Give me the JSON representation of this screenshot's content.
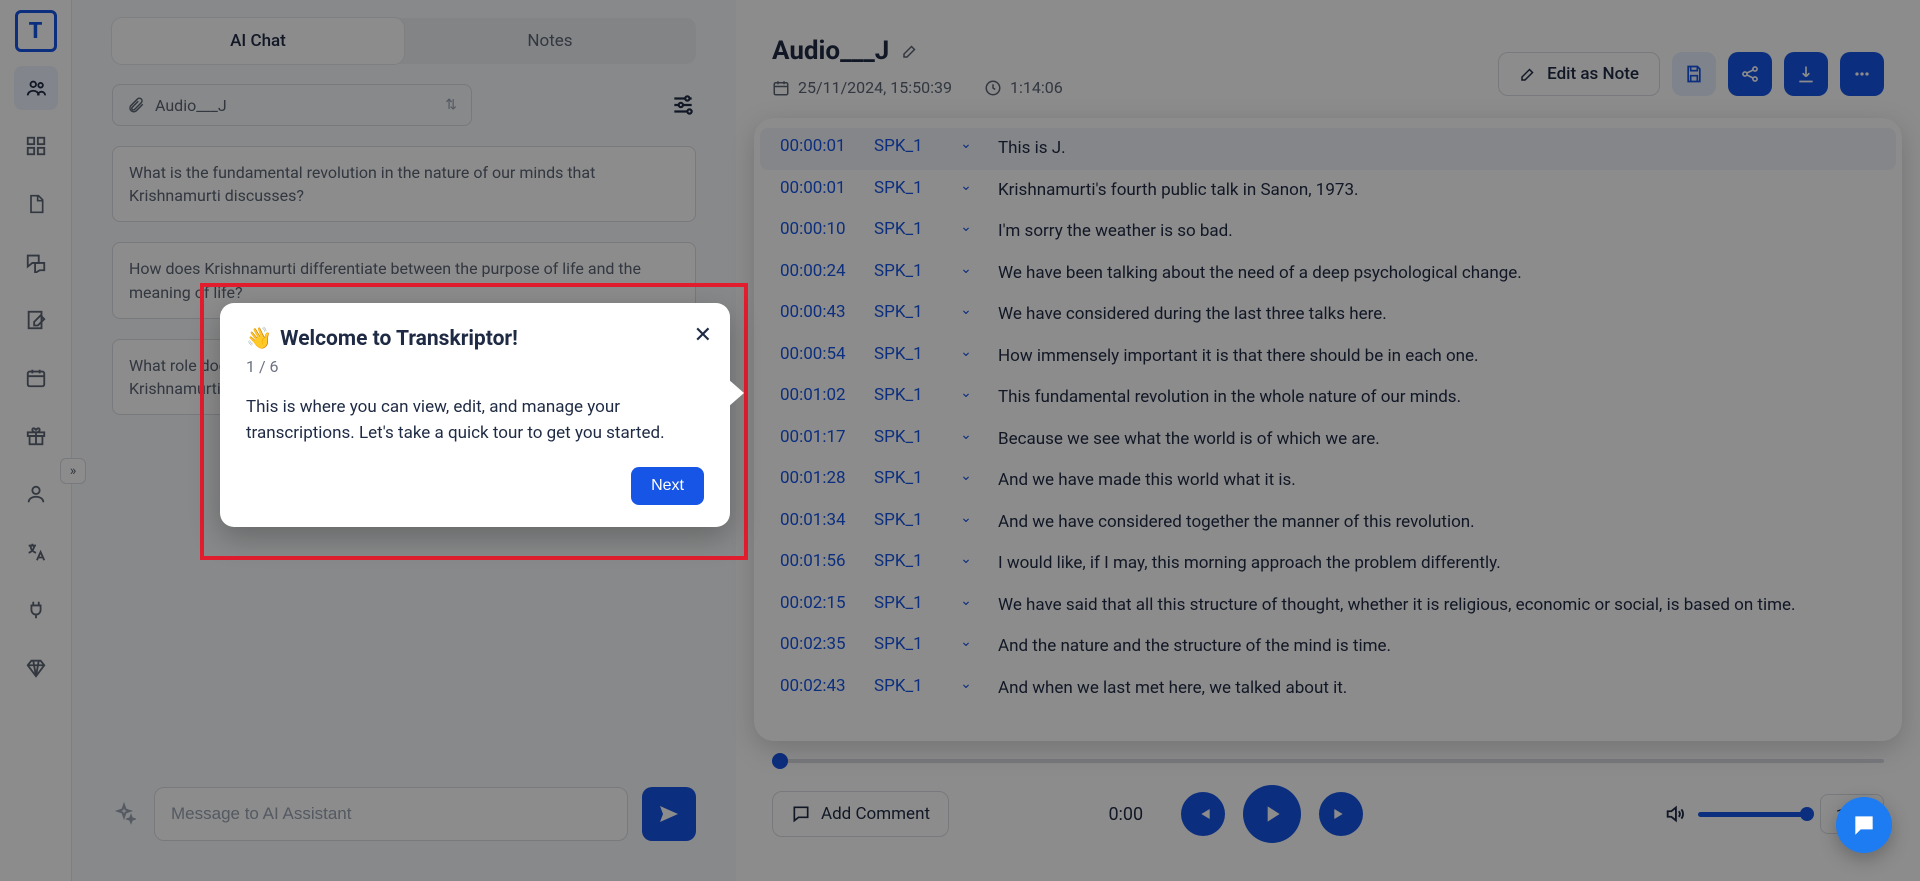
{
  "sidebar": {
    "items": [
      "people",
      "dashboard",
      "document",
      "chat",
      "edit-note",
      "calendar",
      "gift",
      "profile",
      "translate",
      "plug",
      "diamond"
    ]
  },
  "leftPane": {
    "tabs": {
      "chat": "AI Chat",
      "notes": "Notes"
    },
    "file": {
      "name": "Audio___J"
    },
    "questions": [
      "What is the fundamental revolution in the nature of our minds that Krishnamurti discusses?",
      "How does Krishnamurti differentiate between the purpose of life and the meaning of life?",
      "What role does thought play in shaping human experience according to Krishnamurti?"
    ],
    "chat": {
      "placeholder": "Message to AI Assistant"
    }
  },
  "doc": {
    "title": "Audio___J",
    "date": "25/11/2024, 15:50:39",
    "duration": "1:14:06",
    "editNote": "Edit as Note"
  },
  "transcript": [
    {
      "t": "00:00:01",
      "s": "SPK_1",
      "x": "This is J.",
      "hl": true
    },
    {
      "t": "00:00:01",
      "s": "SPK_1",
      "x": "Krishnamurti's fourth public talk in Sanon, 1973."
    },
    {
      "t": "00:00:10",
      "s": "SPK_1",
      "x": "I'm sorry the weather is so bad."
    },
    {
      "t": "00:00:24",
      "s": "SPK_1",
      "x": "We have been talking about the need of a deep psychological change."
    },
    {
      "t": "00:00:43",
      "s": "SPK_1",
      "x": "We have considered during the last three talks here."
    },
    {
      "t": "00:00:54",
      "s": "SPK_1",
      "x": "How immensely important it is that there should be in each one."
    },
    {
      "t": "00:01:02",
      "s": "SPK_1",
      "x": "This fundamental revolution in the whole nature of our minds."
    },
    {
      "t": "00:01:17",
      "s": "SPK_1",
      "x": "Because we see what the world is of which we are."
    },
    {
      "t": "00:01:28",
      "s": "SPK_1",
      "x": "And we have made this world what it is."
    },
    {
      "t": "00:01:34",
      "s": "SPK_1",
      "x": "And we have considered together the manner of this revolution."
    },
    {
      "t": "00:01:56",
      "s": "SPK_1",
      "x": "I would like, if I may, this morning approach the problem differently."
    },
    {
      "t": "00:02:15",
      "s": "SPK_1",
      "x": "We have said that all this structure of thought, whether it is religious, economic or social, is based on time."
    },
    {
      "t": "00:02:35",
      "s": "SPK_1",
      "x": "And the nature and the structure of the mind is time."
    },
    {
      "t": "00:02:43",
      "s": "SPK_1",
      "x": "And when we last met here, we talked about it."
    }
  ],
  "player": {
    "comment": "Add Comment",
    "time": "0:00",
    "speed": "1x"
  },
  "tour": {
    "emoji": "👋",
    "title": "Welcome to Transkriptor!",
    "step": "1 / 6",
    "body": "This is where you can view, edit, and manage your transcriptions. Let's take a quick tour to get you started.",
    "next": "Next"
  }
}
